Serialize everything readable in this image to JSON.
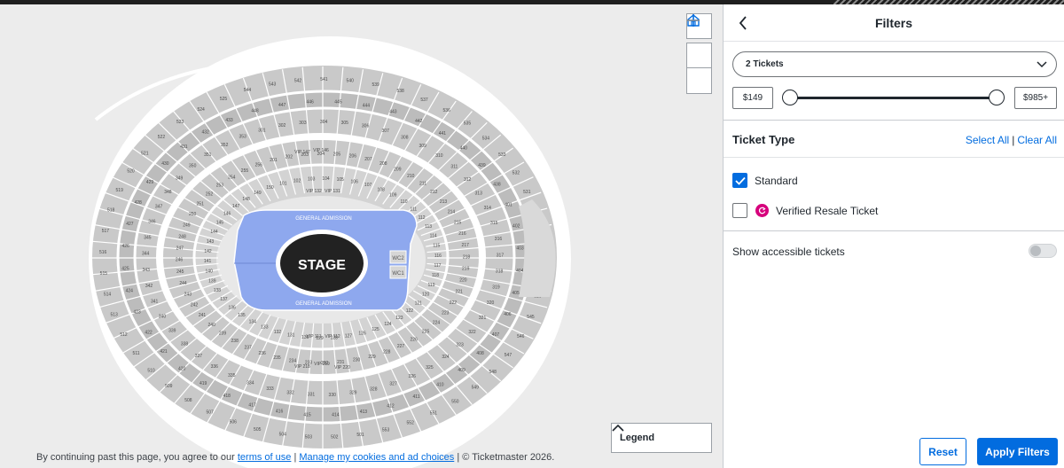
{
  "map": {
    "stage_label": "STAGE",
    "general_admission_top": "GENERAL ADMISSION",
    "general_admission_bottom": "GENERAL ADMISSION",
    "wc_labels": [
      "WC2",
      "WC1"
    ],
    "vip_labels": [
      "VIP 147",
      "VIP 146",
      "VIP 132",
      "VIP 131",
      "VIP 111",
      "VIP 112",
      "VIP 219",
      "VIP 220",
      "VIP 218"
    ],
    "section_labels": [
      "544",
      "543",
      "542",
      "541",
      "540",
      "539",
      "538",
      "537",
      "536",
      "535",
      "534",
      "533",
      "532",
      "531",
      "530",
      "529",
      "528",
      "527",
      "526",
      "545",
      "546",
      "547",
      "548",
      "549",
      "550",
      "551",
      "552",
      "553",
      "448",
      "447",
      "446",
      "445",
      "444",
      "443",
      "442",
      "441",
      "440",
      "439",
      "438",
      "401",
      "402",
      "403",
      "404",
      "405",
      "406",
      "407",
      "408",
      "409",
      "410",
      "411",
      "412",
      "413",
      "414",
      "415",
      "416",
      "417",
      "418",
      "419",
      "420",
      "421",
      "422",
      "423",
      "424",
      "425",
      "426",
      "427",
      "428",
      "429",
      "430",
      "431",
      "432",
      "433",
      "301",
      "302",
      "303",
      "304",
      "305",
      "306",
      "307",
      "308",
      "309",
      "310",
      "311",
      "312",
      "313",
      "314",
      "315",
      "316",
      "317",
      "318",
      "319",
      "320",
      "321",
      "322",
      "323",
      "324",
      "325",
      "326",
      "327",
      "328",
      "329",
      "330",
      "331",
      "332",
      "333",
      "334",
      "335",
      "336",
      "337",
      "338",
      "339",
      "340",
      "341",
      "342",
      "343",
      "344",
      "345",
      "346",
      "347",
      "348",
      "349",
      "350",
      "351",
      "352",
      "353",
      "201",
      "202",
      "203",
      "204",
      "205",
      "206",
      "207",
      "208",
      "209",
      "210",
      "211",
      "212",
      "213",
      "214",
      "215",
      "216",
      "217",
      "218",
      "219",
      "220",
      "221",
      "222",
      "223",
      "224",
      "225",
      "226",
      "227",
      "228",
      "229",
      "230",
      "231",
      "232",
      "233",
      "234",
      "235",
      "236",
      "237",
      "238",
      "239",
      "240",
      "241",
      "242",
      "243",
      "244",
      "245",
      "246",
      "247",
      "248",
      "249",
      "250",
      "251",
      "252",
      "253",
      "254",
      "255",
      "256",
      "101",
      "102",
      "103",
      "104",
      "105",
      "106",
      "107",
      "108",
      "109",
      "110",
      "111",
      "112",
      "113",
      "114",
      "115",
      "116",
      "117",
      "118",
      "119",
      "120",
      "121",
      "122",
      "123",
      "124",
      "125",
      "126",
      "127",
      "128",
      "129",
      "130",
      "131",
      "132",
      "133",
      "134",
      "135",
      "136",
      "137",
      "138",
      "139",
      "140",
      "141",
      "142",
      "143",
      "144",
      "145",
      "146",
      "147",
      "148",
      "149",
      "150",
      "501",
      "502",
      "503",
      "504",
      "505",
      "506",
      "507",
      "508",
      "509",
      "510",
      "511",
      "512",
      "513",
      "514",
      "515",
      "516",
      "517",
      "518",
      "519",
      "520",
      "521",
      "522",
      "523",
      "524",
      "525"
    ],
    "legend_label": "Legend",
    "controls": {
      "home_icon": "home-icon",
      "zoom_in_icon": "plus-icon",
      "zoom_out_icon": "minus-icon"
    }
  },
  "footer": {
    "prefix": "By continuing past this page, you agree to our ",
    "terms_link": "terms of use",
    "sep1": " | ",
    "cookies_link": "Manage my cookies and ad choices",
    "suffix": " | © Ticketmaster 2026."
  },
  "panel": {
    "title": "Filters",
    "back_icon": "chevron-left-icon",
    "ticket_qty": "2 Tickets",
    "price_min": "$149",
    "price_max": "$985+",
    "ticket_type_title": "Ticket Type",
    "select_all": "Select All",
    "clear_all": "Clear All",
    "link_separator": "|",
    "options": [
      {
        "label": "Standard",
        "checked": true
      },
      {
        "label": "Verified Resale Ticket",
        "checked": false
      }
    ],
    "accessible_label": "Show accessible tickets",
    "accessible_on": false,
    "reset_label": "Reset",
    "apply_label": "Apply Filters"
  },
  "colors": {
    "accent": "#026cdf",
    "ga_floor": "#8ea8ee",
    "section_fill": "#c9c9c9",
    "resale_badge": "#d6007c"
  }
}
